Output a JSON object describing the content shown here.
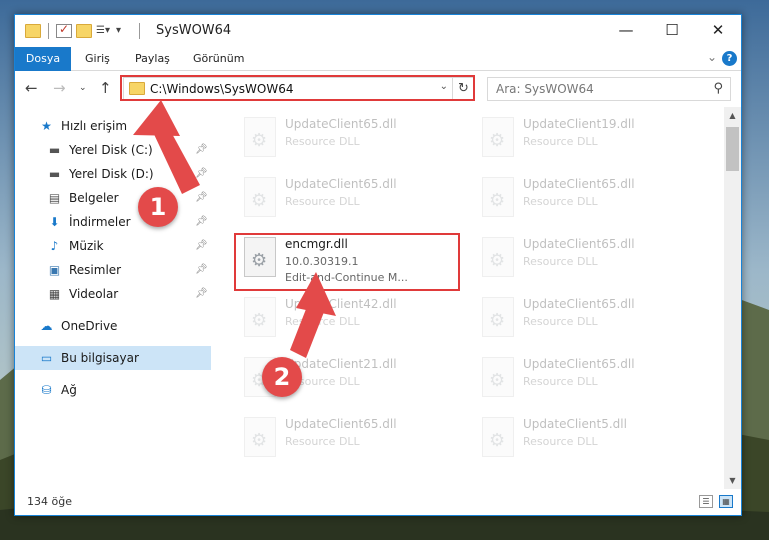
{
  "window": {
    "title": "SysWOW64",
    "minimize": "—",
    "maximize": "☐",
    "close": "✕"
  },
  "ribbon": {
    "tabs": [
      "Dosya",
      "Giriş",
      "Paylaş",
      "Görünüm"
    ],
    "help": "?"
  },
  "address": {
    "path": "C:\\Windows\\SysWOW64"
  },
  "search": {
    "placeholder": "Ara: SysWOW64"
  },
  "nav": {
    "quick_access": "Hızlı erişim",
    "items": [
      {
        "label": "Yerel Disk (C:)",
        "icon": "drive-icon"
      },
      {
        "label": "Yerel Disk (D:)",
        "icon": "drive-icon"
      },
      {
        "label": "Belgeler",
        "icon": "documents-icon"
      },
      {
        "label": "İndirmeler",
        "icon": "downloads-icon"
      },
      {
        "label": "Müzik",
        "icon": "music-icon"
      },
      {
        "label": "Resimler",
        "icon": "pictures-icon"
      },
      {
        "label": "Videolar",
        "icon": "videos-icon"
      }
    ],
    "onedrive": "OneDrive",
    "this_pc": "Bu bilgisayar",
    "network": "Ağ"
  },
  "files": {
    "left": [
      {
        "name": "UpdateClient65.dll",
        "sub": "Resource DLL"
      },
      {
        "name": "UpdateClient65.dll",
        "sub": "Resource DLL"
      },
      {
        "name": "encmgr.dll",
        "sub": "10.0.30319.1",
        "sub2": "Edit-and-Continue M..."
      },
      {
        "name": "UpdateClient42.dll",
        "sub": "Resource DLL"
      },
      {
        "name": "UpdateClient21.dll",
        "sub": "Resource DLL"
      },
      {
        "name": "UpdateClient65.dll",
        "sub": "Resource DLL"
      }
    ],
    "right": [
      {
        "name": "UpdateClient19.dll",
        "sub": "Resource DLL"
      },
      {
        "name": "UpdateClient65.dll",
        "sub": "Resource DLL"
      },
      {
        "name": "UpdateClient65.dll",
        "sub": "Resource DLL"
      },
      {
        "name": "UpdateClient65.dll",
        "sub": "Resource DLL"
      },
      {
        "name": "UpdateClient65.dll",
        "sub": "Resource DLL"
      },
      {
        "name": "UpdateClient5.dll",
        "sub": "Resource DLL"
      }
    ]
  },
  "status": {
    "count": "134 öğe"
  },
  "annotations": {
    "step1": "1",
    "step2": "2",
    "color": "#e34a4a"
  }
}
